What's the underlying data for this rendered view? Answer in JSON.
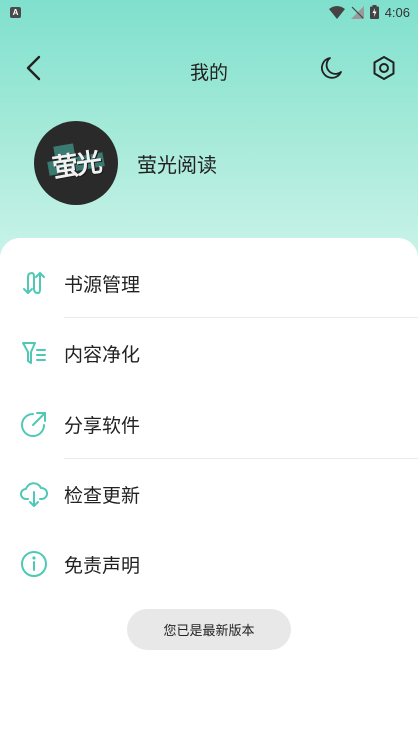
{
  "status_bar": {
    "app_badge": "A",
    "time": "4:06"
  },
  "header": {
    "title": "我的",
    "back_icon": "chevron-left-icon",
    "theme_icon": "moon-icon",
    "settings_icon": "gear-icon"
  },
  "profile": {
    "logo_text": "萤光",
    "app_name": "萤光阅读"
  },
  "menu": {
    "items": [
      {
        "label": "书源管理",
        "icon": "swap-arrows-icon"
      },
      {
        "label": "内容净化",
        "icon": "filter-icon"
      },
      {
        "label": "分享软件",
        "icon": "share-icon"
      },
      {
        "label": "检查更新",
        "icon": "cloud-download-icon"
      },
      {
        "label": "免责声明",
        "icon": "info-icon"
      }
    ]
  },
  "toast": {
    "message": "您已是最新版本"
  },
  "colors": {
    "accent": "#4fc9b6",
    "gradient_top": "#7fe0cd",
    "gradient_bottom": "#d6f6ee",
    "text": "#222222",
    "toast_bg": "#e8e8e8"
  }
}
